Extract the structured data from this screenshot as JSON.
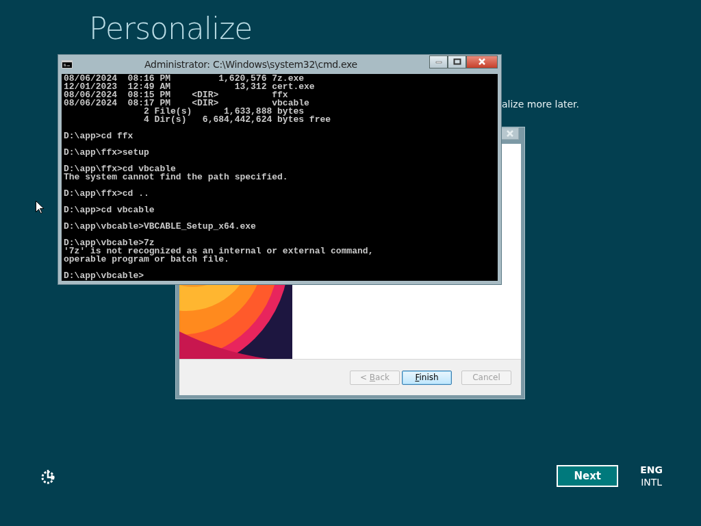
{
  "setup_page": {
    "heading": "Personalize",
    "text_fragment": "alize more later."
  },
  "cmd_window": {
    "title": "Administrator: C:\\Windows\\system32\\cmd.exe",
    "blocks": [
      [
        "08/06/2024  08:16 PM         1,620,576 7z.exe",
        "12/01/2023  12:49 AM            13,312 cert.exe",
        "08/06/2024  08:15 PM    <DIR>          ffx",
        "08/06/2024  08:17 PM    <DIR>          vbcable",
        "               2 File(s)      1,633,888 bytes",
        "               4 Dir(s)   6,684,442,624 bytes free"
      ],
      [
        "D:\\app>cd ffx"
      ],
      [
        "D:\\app\\ffx>setup"
      ],
      [
        "D:\\app\\ffx>cd vbcable",
        "The system cannot find the path specified."
      ],
      [
        "D:\\app\\ffx>cd .."
      ],
      [
        "D:\\app>cd vbcable"
      ],
      [
        "D:\\app\\vbcable>VBCABLE_Setup_x64.exe"
      ],
      [
        "D:\\app\\vbcable>7z",
        "'7z' is not recognized as an internal or external command,",
        "operable program or batch file."
      ],
      [
        "D:\\app\\vbcable>"
      ]
    ]
  },
  "installer_window": {
    "buttons": [
      {
        "before": "< ",
        "key": "B",
        "after": "ack",
        "disabled": true,
        "default": false
      },
      {
        "key": "F",
        "after": "inish",
        "disabled": false,
        "default": true
      },
      {
        "after": "Cancel",
        "disabled": true,
        "default": false
      }
    ]
  },
  "footer": {
    "next_button": "Next",
    "language": "ENG",
    "layout": "INTL"
  }
}
